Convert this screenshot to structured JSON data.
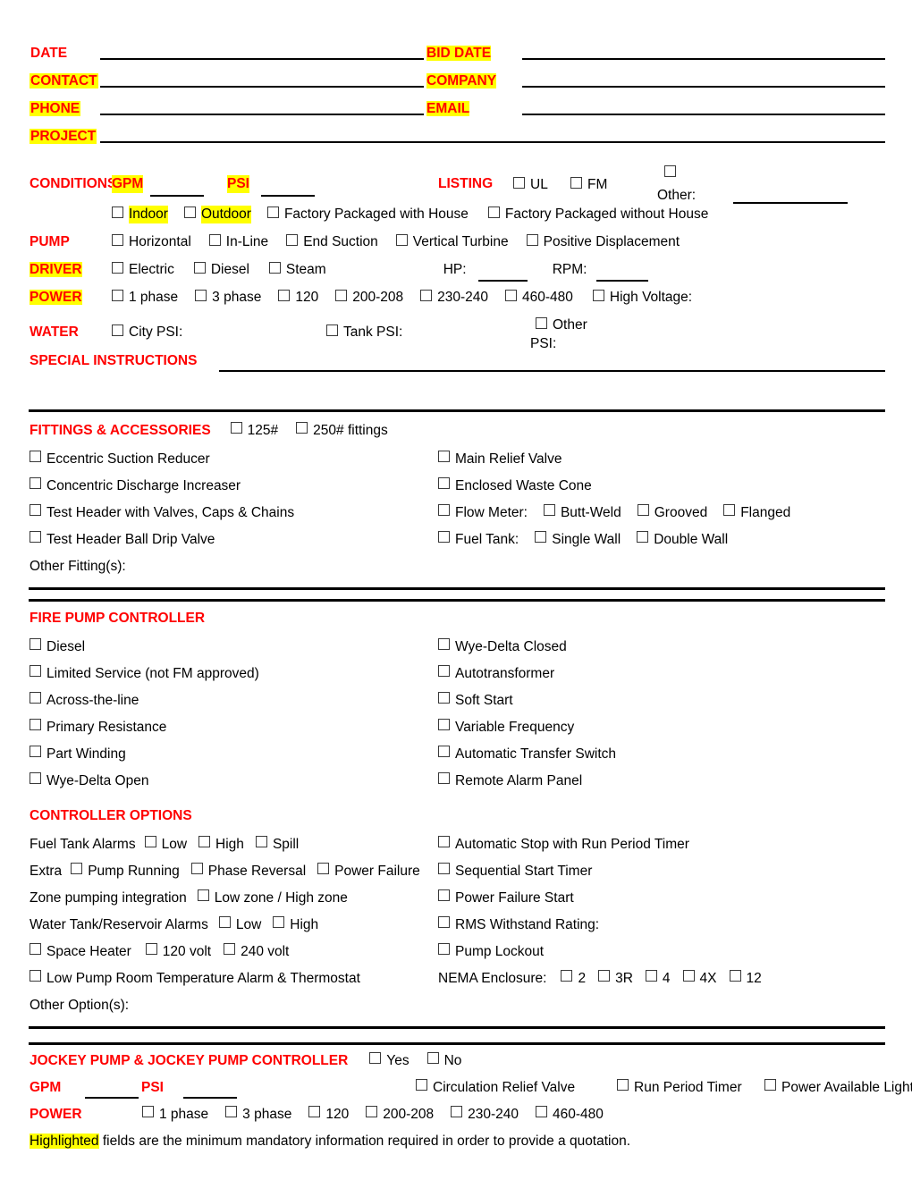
{
  "header": {
    "fields_left": [
      {
        "label": "DATE",
        "highlighted": false
      },
      {
        "label": "CONTACT",
        "highlighted": true
      },
      {
        "label": "PHONE",
        "highlighted": true
      },
      {
        "label": "PROJECT",
        "highlighted": true
      }
    ],
    "fields_right": [
      {
        "label": "BID DATE",
        "highlighted": true
      },
      {
        "label": "COMPANY",
        "highlighted": true
      },
      {
        "label": "EMAIL",
        "highlighted": true
      }
    ]
  },
  "conditions": {
    "title": "CONDITIONS",
    "gpm_label": "GPM",
    "psi_label": "PSI",
    "listing_label": "LISTING",
    "listing_options": [
      "UL",
      "FM"
    ],
    "listing_other_label": "Other:",
    "location_options": [
      "Indoor",
      "Outdoor",
      "Factory Packaged with House",
      "Factory Packaged without House"
    ],
    "pump_label": "PUMP",
    "pump_options": [
      "Horizontal",
      "In-Line",
      "End Suction",
      "Vertical Turbine",
      "Positive Displacement"
    ],
    "driver_label": "DRIVER",
    "driver_options": [
      "Electric",
      "Diesel",
      "Steam"
    ],
    "hp_label": "HP:",
    "rpm_label": "RPM:",
    "power_label": "POWER",
    "power_options": [
      "1 phase",
      "3 phase",
      "120",
      "200-208",
      "230-240",
      "460-480"
    ],
    "high_voltage_label": "High Voltage:",
    "water_label": "WATER",
    "water_city_label": "City PSI:",
    "water_tank_label": "Tank PSI:",
    "water_other_label": "Other",
    "water_other_psi_label": "PSI:",
    "special_instructions_label": "SPECIAL INSTRUCTIONS"
  },
  "fittings": {
    "title": "FITTINGS & ACCESSORIES",
    "rating_options": [
      "125#",
      "250# fittings"
    ],
    "left_items": [
      "Eccentric Suction Reducer",
      "Concentric Discharge Increaser",
      "Test Header with Valves, Caps & Chains",
      "Test Header Ball Drip Valve"
    ],
    "right_items": [
      {
        "label": "Main Relief Valve",
        "sub": []
      },
      {
        "label": "Enclosed Waste Cone",
        "sub": []
      },
      {
        "label": "Flow Meter:",
        "sub": [
          "Butt-Weld",
          "Grooved",
          "Flanged"
        ]
      },
      {
        "label": "Fuel Tank:",
        "sub": [
          "Single Wall",
          "Double Wall"
        ]
      }
    ],
    "other_label": "Other Fitting(s):"
  },
  "controller": {
    "title": "FIRE PUMP CONTROLLER",
    "left_items": [
      "Diesel",
      "Limited Service (not FM approved)",
      "Across-the-line",
      "Primary Resistance",
      "Part Winding",
      "Wye-Delta Open"
    ],
    "right_items": [
      "Wye-Delta Closed",
      "Autotransformer",
      "Soft Start",
      "Variable Frequency",
      "Automatic Transfer Switch",
      "Remote Alarm Panel"
    ]
  },
  "controller_options": {
    "title": "CONTROLLER OPTIONS",
    "left_rows": [
      {
        "prefix": "Fuel Tank Alarms",
        "boxes": [
          "Low",
          "High",
          "Spill"
        ]
      },
      {
        "prefix": "Extra",
        "boxes": [
          "Pump Running",
          "Phase Reversal",
          "Power Failure"
        ]
      },
      {
        "prefix": "Zone pumping integration",
        "boxes": [
          "Low zone / High zone"
        ]
      },
      {
        "prefix": "Water Tank/Reservoir Alarms",
        "boxes": [
          "Low",
          "High"
        ]
      },
      {
        "prefix": "",
        "boxes": [
          "Space Heater",
          "120 volt",
          "240 volt"
        ]
      },
      {
        "prefix": "",
        "boxes": [
          "Low Pump Room Temperature Alarm & Thermostat"
        ]
      }
    ],
    "right_rows": [
      {
        "prefix": "",
        "boxes": [
          "Automatic Stop with Run Period Timer"
        ]
      },
      {
        "prefix": "",
        "boxes": [
          "Sequential Start Timer"
        ]
      },
      {
        "prefix": "",
        "boxes": [
          "Power Failure Start"
        ]
      },
      {
        "prefix": "",
        "boxes": [
          "RMS Withstand Rating:"
        ]
      },
      {
        "prefix": "",
        "boxes": [
          "Pump Lockout"
        ]
      },
      {
        "prefix": "NEMA Enclosure:",
        "boxes": [
          "2",
          "3R",
          "4",
          "4X",
          "12"
        ]
      }
    ],
    "other_label": "Other Option(s):"
  },
  "jockey": {
    "title": "JOCKEY PUMP & JOCKEY PUMP CONTROLLER",
    "yes_no": [
      "Yes",
      "No"
    ],
    "gpm_label": "GPM",
    "psi_label": "PSI",
    "accessory_options": [
      "Circulation Relief Valve",
      "Run Period Timer",
      "Power Available Light"
    ],
    "power_label": "POWER",
    "power_options": [
      "1 phase",
      "3 phase",
      "120",
      "200-208",
      "230-240",
      "460-480"
    ]
  },
  "footnote": {
    "highlight_word": "Highlighted",
    "text": " fields are the minimum mandatory information required in order to provide a quotation."
  },
  "colors": {
    "accent_red": "#ff0000",
    "highlight_yellow": "#ffff00",
    "rule_black": "#000000"
  }
}
